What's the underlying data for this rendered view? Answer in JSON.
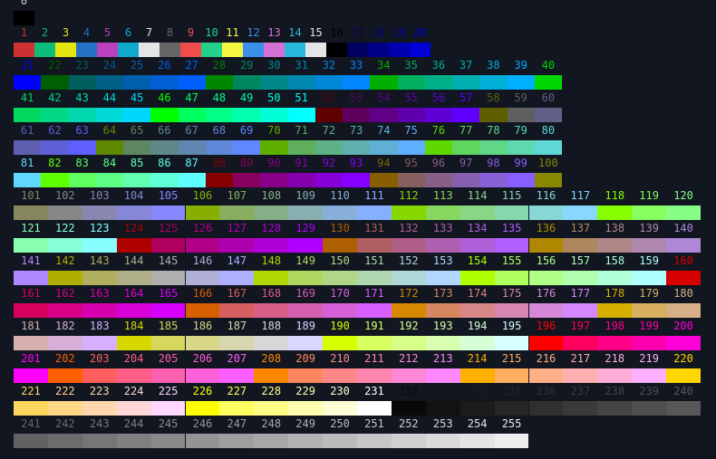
{
  "background": "#111621",
  "entries": [
    {
      "n": "0",
      "color": "#000000"
    },
    {
      "n": "1",
      "color": "#cd3131"
    },
    {
      "n": "2",
      "color": "#0dbc79"
    },
    {
      "n": "3",
      "color": "#e5e510"
    },
    {
      "n": "4",
      "color": "#2472c8"
    },
    {
      "n": "5",
      "color": "#bc3fbc"
    },
    {
      "n": "6",
      "color": "#11a8cd"
    },
    {
      "n": "7",
      "color": "#e5e5e5"
    },
    {
      "n": "8",
      "color": "#666666"
    },
    {
      "n": "9",
      "color": "#f14c4c"
    },
    {
      "n": "10",
      "color": "#23d18b"
    },
    {
      "n": "11",
      "color": "#f5f543"
    },
    {
      "n": "12",
      "color": "#3b8eea"
    },
    {
      "n": "13",
      "color": "#d670d6"
    },
    {
      "n": "14",
      "color": "#29b8db"
    },
    {
      "n": "15",
      "color": "#e5e5e5"
    }
  ]
}
